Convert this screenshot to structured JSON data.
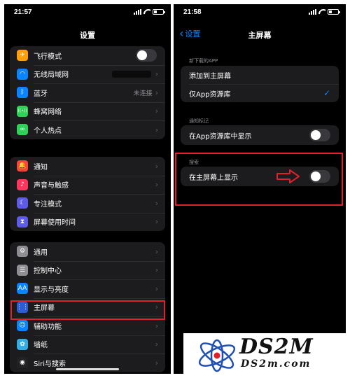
{
  "left": {
    "status_time": "21:57",
    "title": "设置",
    "group1": [
      {
        "label": "飞行模式",
        "icon": "airplane-icon",
        "color": "#ff9f0a",
        "glyph": "✈",
        "type": "toggle"
      },
      {
        "label": "无线局域网",
        "icon": "wifi-icon",
        "color": "#0a84ff",
        "glyph": "◠",
        "type": "redacted"
      },
      {
        "label": "蓝牙",
        "icon": "bluetooth-icon",
        "color": "#0a84ff",
        "glyph": "ᛒ",
        "type": "value",
        "value": "未连接"
      },
      {
        "label": "蜂窝网络",
        "icon": "cellular-icon",
        "color": "#30d158",
        "glyph": "((•))",
        "type": "chevron"
      },
      {
        "label": "个人热点",
        "icon": "hotspot-icon",
        "color": "#30d158",
        "glyph": "∞",
        "type": "chevron"
      }
    ],
    "group2": [
      {
        "label": "通知",
        "icon": "bell-icon",
        "color": "#ff453a",
        "glyph": "🔔",
        "type": "chevron"
      },
      {
        "label": "声音与触感",
        "icon": "speaker-icon",
        "color": "#ff375f",
        "glyph": "♪",
        "type": "chevron"
      },
      {
        "label": "专注模式",
        "icon": "moon-icon",
        "color": "#5e5ce6",
        "glyph": "☾",
        "type": "chevron"
      },
      {
        "label": "屏幕使用时间",
        "icon": "hourglass-icon",
        "color": "#5e5ce6",
        "glyph": "⧗",
        "type": "chevron"
      }
    ],
    "group3": [
      {
        "label": "通用",
        "icon": "gear-icon",
        "color": "#8e8e93",
        "glyph": "⚙",
        "type": "chevron"
      },
      {
        "label": "控制中心",
        "icon": "switches-icon",
        "color": "#8e8e93",
        "glyph": "☰",
        "type": "chevron"
      },
      {
        "label": "显示与亮度",
        "icon": "text-size-icon",
        "color": "#0a84ff",
        "glyph": "AA",
        "type": "chevron"
      },
      {
        "label": "主屏幕",
        "icon": "home-grid-icon",
        "color": "#2c5dd6",
        "glyph": "⋮⋮",
        "type": "chevron"
      },
      {
        "label": "辅助功能",
        "icon": "accessibility-icon",
        "color": "#0a84ff",
        "glyph": "☺",
        "type": "chevron"
      },
      {
        "label": "墙纸",
        "icon": "flower-icon",
        "color": "#32ade6",
        "glyph": "✿",
        "type": "chevron"
      },
      {
        "label": "Siri与搜索",
        "icon": "siri-icon",
        "color": "#222222",
        "glyph": "◉",
        "type": "chevron"
      }
    ]
  },
  "right": {
    "status_time": "21:58",
    "back_label": "设置",
    "title": "主屏幕",
    "section1_header": "新下载的APP",
    "option1": "添加到主屏幕",
    "option2": "仅App资源库",
    "section2_header": "通知标记",
    "badge_row": "在App资源库中显示",
    "section3_header": "搜索",
    "search_row": "在主屏幕上显示"
  },
  "watermark": {
    "title": "DS2M",
    "url": "DS2m.com"
  },
  "colors": {
    "highlight_border": "#e0202a",
    "accent": "#0a84ff"
  }
}
